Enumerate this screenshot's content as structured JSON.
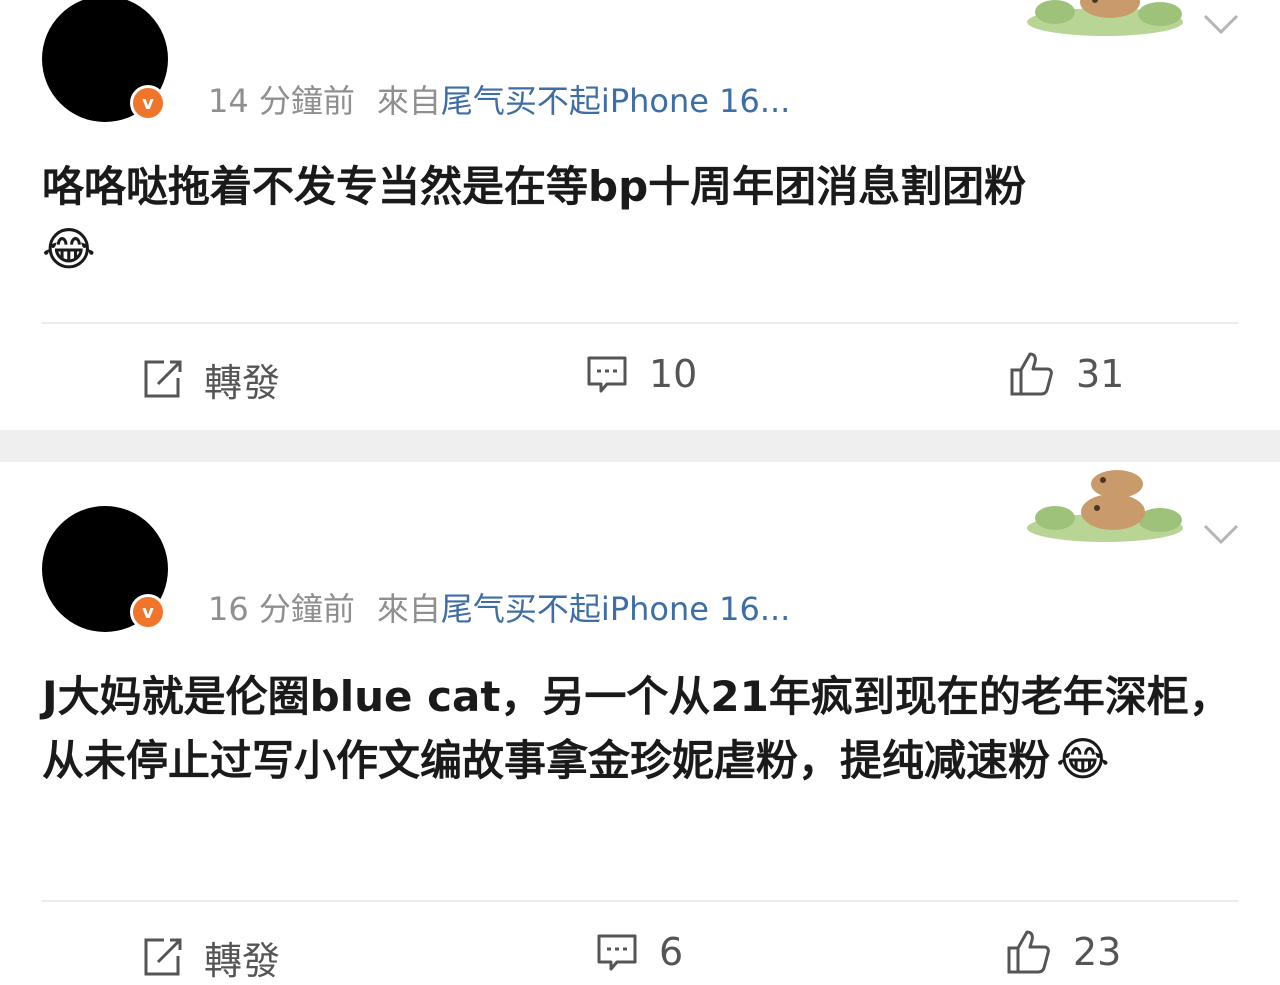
{
  "posts": [
    {
      "time": "14 分鐘前",
      "source_prefix": "來自",
      "source_device": "尾气买不起iPhone 16...",
      "text": "咯咯哒拖着不发专当然是在等bp十周年团消息割团粉",
      "emoji": "😂",
      "repost_label": "轉發",
      "comment_count": "10",
      "like_count": "31",
      "verified_badge": "v"
    },
    {
      "time": "16 分鐘前",
      "source_prefix": "來自",
      "source_device": "尾气买不起iPhone 16...",
      "text": "J大妈就是伦圈blue cat，另一个从21年疯到现在的老年深柜，从未停止过写小作文编故事拿金珍妮虐粉，提纯减速粉",
      "emoji": "😂",
      "repost_label": "轉發",
      "comment_count": "6",
      "like_count": "23",
      "verified_badge": "v"
    }
  ],
  "colors": {
    "accent_link": "#3f6da5",
    "verified_badge": "#f0752a",
    "meta_gray": "#8f8f8f",
    "separator": "#efefef"
  },
  "icons": [
    "verified-badge-icon",
    "chevron-down-icon",
    "repost-icon",
    "comment-icon",
    "like-icon",
    "capybara-sticker"
  ]
}
